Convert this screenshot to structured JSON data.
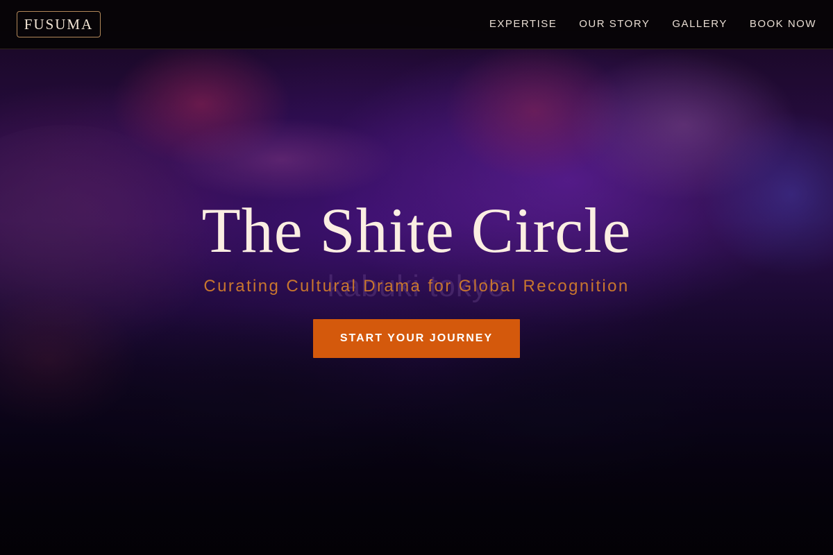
{
  "nav": {
    "logo": "FUSUMA",
    "links": [
      "EXPERTISE",
      "OUR STORY",
      "GALLERY",
      "BOOK NOW"
    ]
  },
  "hero": {
    "title": "The Shite Circle",
    "background_text": "kabuki tokyo",
    "subtitle": "Curating Cultural Drama for Global Recognition",
    "cta_label": "START YOUR JOURNEY"
  },
  "colors": {
    "accent": "#d4590c",
    "subtitle": "#c8762e",
    "title": "#fbeee2",
    "nav_background": "#060406"
  }
}
